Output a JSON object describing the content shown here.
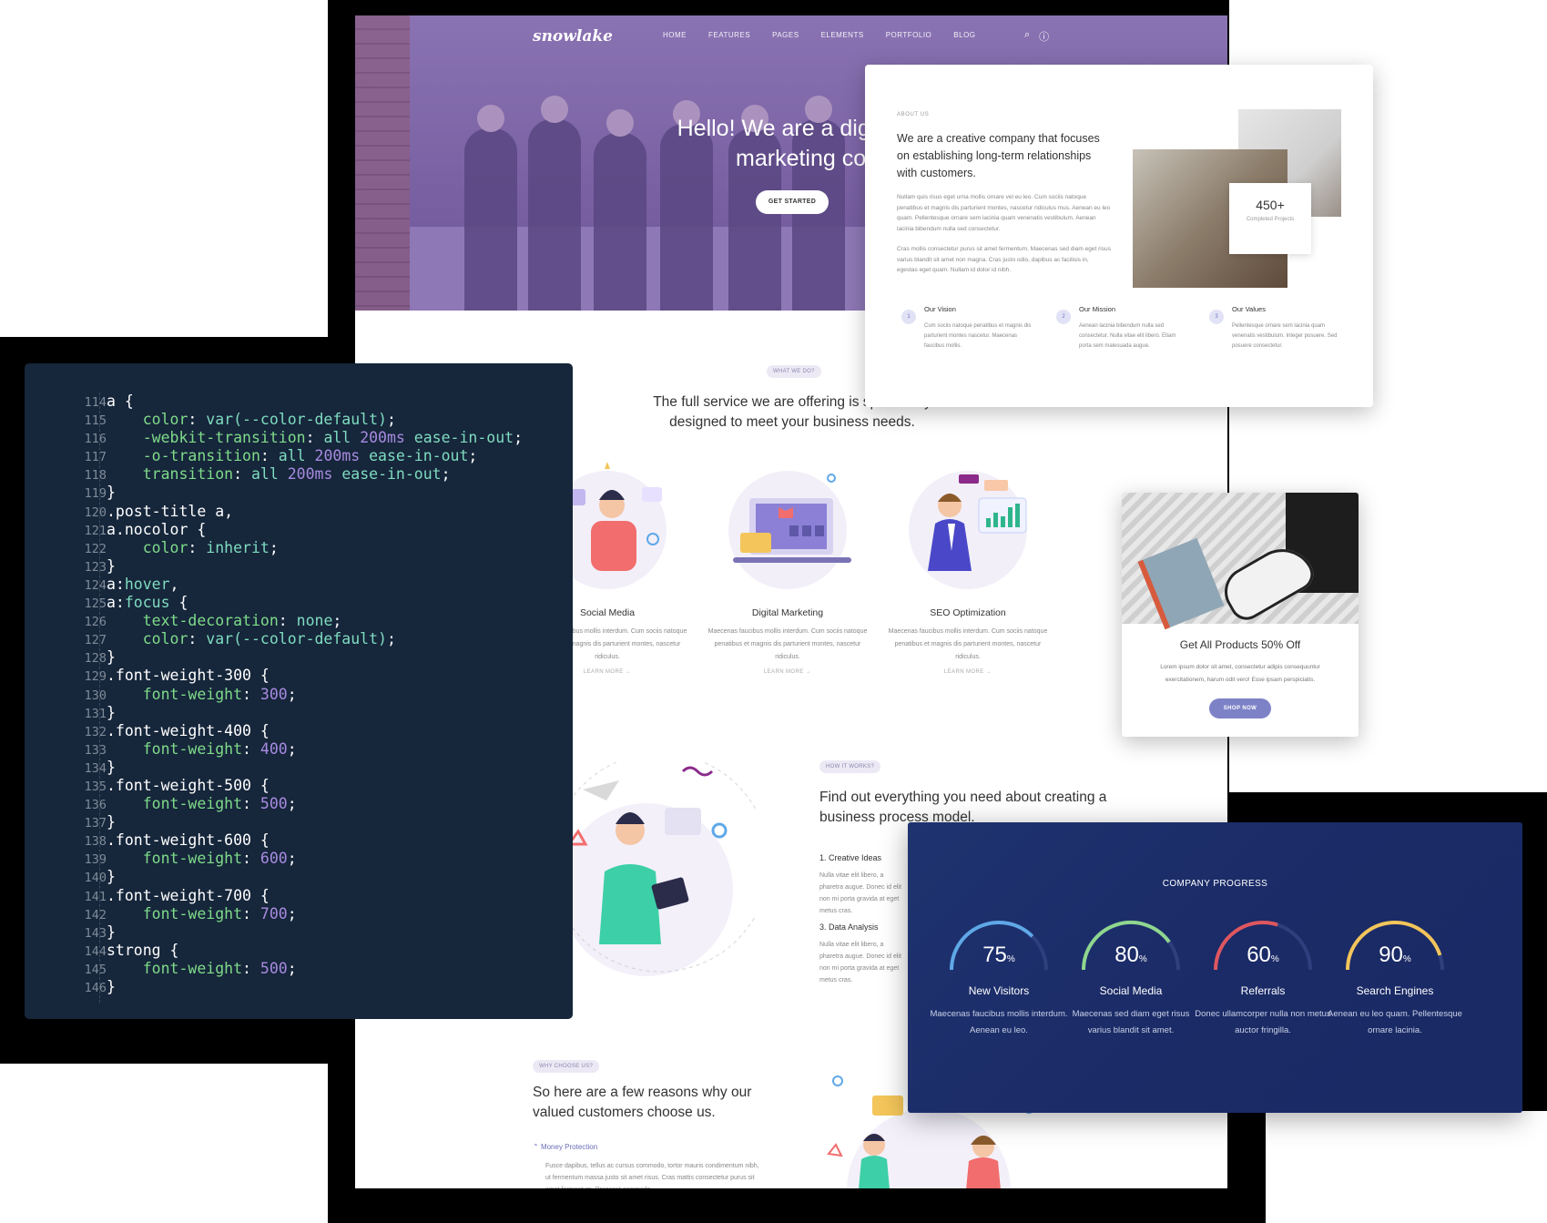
{
  "site": {
    "logo": "snowlake",
    "nav": [
      "HOME",
      "FEATURES",
      "PAGES",
      "ELEMENTS",
      "PORTFOLIO",
      "BLOG"
    ],
    "hero_title": "Hello! We are a digital and marketing com",
    "hero_button": "GET STARTED",
    "what_tag": "WHAT WE DO?",
    "what_title": "The full service we are offering is specifically designed to meet your business needs.",
    "services": [
      {
        "name": "Social Media",
        "text": "Maecenas faucibus mollis interdum. Cum sociis natoque penatibus et magnis dis parturient montes, nascetur ridiculus.",
        "link": "LEARN MORE →"
      },
      {
        "name": "Digital Marketing",
        "text": "Maecenas faucibus mollis interdum. Cum sociis natoque penatibus et magnis dis parturient montes, nascetur ridiculus.",
        "link": "LEARN MORE →"
      },
      {
        "name": "SEO Optimization",
        "text": "Maecenas faucibus mollis interdum. Cum sociis natoque penatibus et magnis dis parturient montes, nascetur ridiculus.",
        "link": "LEARN MORE →"
      }
    ],
    "how_tag": "HOW IT WORKS?",
    "how_title": "Find out everything you need about creating a business process model.",
    "steps": [
      {
        "title": "1. Creative Ideas",
        "text": "Nulla vitae elit libero, a pharetra augue. Donec id elit non mi porta gravida at eget metus cras."
      },
      {
        "title": "3. Data Analysis",
        "text": "Nulla vitae elit libero, a pharetra augue. Donec id elit non mi porta gravida at eget metus cras."
      }
    ],
    "why_tag": "WHY CHOOSE US?",
    "why_title": "So here are a few reasons why our valued customers choose us.",
    "why_item": "Money Protection",
    "why_text": "Fusce dapibus, tellus ac cursus commodo, tortor mauris condimentum nibh, ut fermentum massa justo sit amet risus. Cras mattis consectetur purus sit amet fermentum. Praesent commodo"
  },
  "about": {
    "tag": "ABOUT US",
    "title": "We are a creative company that focuses on establishing long-term relationships with customers.",
    "para1": "Nullam quis risus eget urna mollis ornare vel eu leo. Cum sociis natoque penatibus et magnis dis parturient montes, nascetur ridiculus mus. Aenean eu leo quam. Pellentesque ornare sem lacinia quam venenatis vestibulum. Aenean lacinia bibendum nulla sed consectetur.",
    "para2": "Cras mollis consectetur purus sit amet fermentum. Maecenas sed diam eget risus varius blandit sit amet non magna. Cras justo odio, dapibus ac facilisis in, egestas eget quam. Nullam id dolor id nibh.",
    "counter_value": "450+",
    "counter_label": "Completed Projects",
    "items": [
      {
        "num": "1",
        "title": "Our Vision",
        "text": "Cum sociis natoque penatibus et magnis dis parturient montes nascetur. Maecenas faucibus mollis."
      },
      {
        "num": "2",
        "title": "Our Mission",
        "text": "Aenean lacinia bibendum nulla sed consectetur. Nulla vitae elit libero. Etiam porta sem malesuada augue."
      },
      {
        "num": "3",
        "title": "Our Values",
        "text": "Pellentesque ornare sem lacinia quam venenatis vestibulum. Integer posuere. Sed posuere consectetur."
      }
    ]
  },
  "code": {
    "lines": [
      {
        "n": "114",
        "html": "a {"
      },
      {
        "n": "115",
        "html": "    <span class=\"c-prop\">color</span>: <span class=\"c-kw\">var(--color-default)</span>;"
      },
      {
        "n": "116",
        "html": "    <span class=\"c-prop\">-webkit-transition</span>: <span class=\"c-kw\">all</span> <span class=\"c-val\">200ms</span> <span class=\"c-kw\">ease-in-out</span>;"
      },
      {
        "n": "117",
        "html": "    <span class=\"c-prop\">-o-transition</span>: <span class=\"c-kw\">all</span> <span class=\"c-val\">200ms</span> <span class=\"c-kw\">ease-in-out</span>;"
      },
      {
        "n": "118",
        "html": "    <span class=\"c-prop\">transition</span>: <span class=\"c-kw\">all</span> <span class=\"c-val\">200ms</span> <span class=\"c-kw\">ease-in-out</span>;"
      },
      {
        "n": "119",
        "html": "}"
      },
      {
        "n": "120",
        "html": ".post-title a,"
      },
      {
        "n": "121",
        "html": "a.nocolor {"
      },
      {
        "n": "122",
        "html": "    <span class=\"c-prop\">color</span>: <span class=\"c-kw\">inherit</span>;"
      },
      {
        "n": "123",
        "html": "}"
      },
      {
        "n": "124",
        "html": "a:<span class=\"c-kw\">hover</span>,"
      },
      {
        "n": "125",
        "html": "a:<span class=\"c-kw\">focus</span> {"
      },
      {
        "n": "126",
        "html": "    <span class=\"c-prop\">text-decoration</span>: <span class=\"c-kw\">none</span>;"
      },
      {
        "n": "127",
        "html": "    <span class=\"c-prop\">color</span>: <span class=\"c-kw\">var(--color-default)</span>;"
      },
      {
        "n": "128",
        "html": "}"
      },
      {
        "n": "129",
        "html": ".font-weight-300 {"
      },
      {
        "n": "130",
        "html": "    <span class=\"c-prop\">font-weight</span>: <span class=\"c-val\">300</span>;"
      },
      {
        "n": "131",
        "html": "}"
      },
      {
        "n": "132",
        "html": ".font-weight-400 {"
      },
      {
        "n": "133",
        "html": "    <span class=\"c-prop\">font-weight</span>: <span class=\"c-val\">400</span>;"
      },
      {
        "n": "134",
        "html": "}"
      },
      {
        "n": "135",
        "html": ".font-weight-500 {"
      },
      {
        "n": "136",
        "html": "    <span class=\"c-prop\">font-weight</span>: <span class=\"c-val\">500</span>;"
      },
      {
        "n": "137",
        "html": "}"
      },
      {
        "n": "138",
        "html": ".font-weight-600 {"
      },
      {
        "n": "139",
        "html": "    <span class=\"c-prop\">font-weight</span>: <span class=\"c-val\">600</span>;"
      },
      {
        "n": "140",
        "html": "}"
      },
      {
        "n": "141",
        "html": ".font-weight-700 {"
      },
      {
        "n": "142",
        "html": "    <span class=\"c-prop\">font-weight</span>: <span class=\"c-val\">700</span>;"
      },
      {
        "n": "143",
        "html": "}"
      },
      {
        "n": "144",
        "html": "strong {"
      },
      {
        "n": "145",
        "html": "    <span class=\"c-prop\">font-weight</span>: <span class=\"c-val\">500</span>;"
      },
      {
        "n": "146",
        "html": "}"
      }
    ]
  },
  "shop": {
    "title": "Get All Products 50% Off",
    "text": "Lorem ipsum dolor sit amet, consectetur adipis consequuntur exercitationem, harum odit vero! Esse ipsam perspiciatis.",
    "button": "SHOP NOW"
  },
  "progress": {
    "heading": "COMPANY PROGRESS",
    "gauges": [
      {
        "value": 75,
        "name": "New Visitors",
        "desc": "Maecenas faucibus mollis interdum. Aenean eu leo.",
        "color": "#5fa8e8"
      },
      {
        "value": 80,
        "name": "Social Media",
        "desc": "Maecenas sed diam eget risus varius blandit sit amet.",
        "color": "#8fd68f"
      },
      {
        "value": 60,
        "name": "Referrals",
        "desc": "Donec ullamcorper nulla non metus auctor fringilla.",
        "color": "#e0565f"
      },
      {
        "value": 90,
        "name": "Search Engines",
        "desc": "Aenean eu leo quam. Pellentesque ornare lacinia.",
        "color": "#f3c55a"
      }
    ]
  }
}
